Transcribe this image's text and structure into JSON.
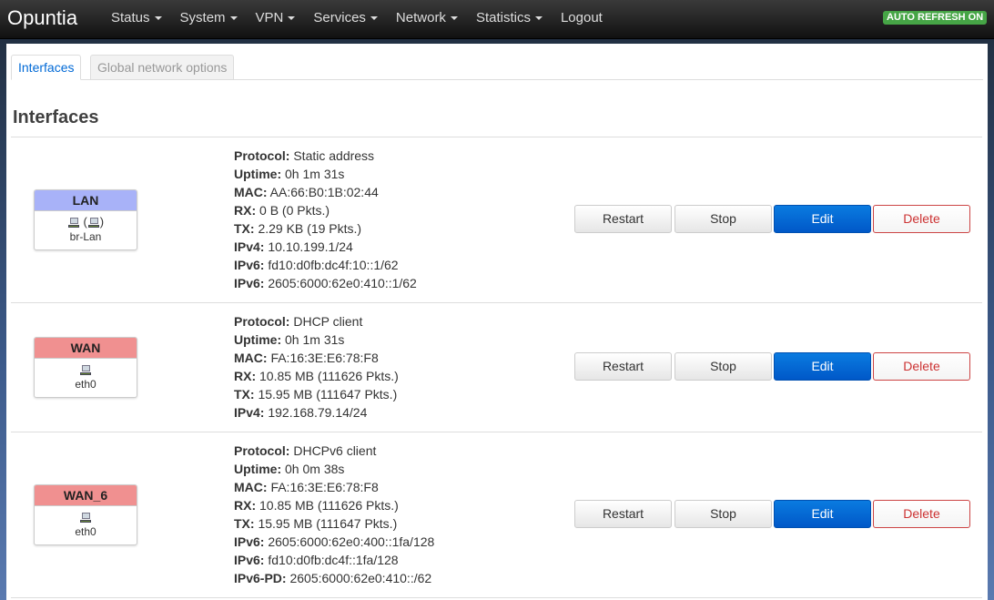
{
  "brand": "Opuntia",
  "menu": [
    {
      "label": "Status",
      "dropdown": true
    },
    {
      "label": "System",
      "dropdown": true
    },
    {
      "label": "VPN",
      "dropdown": true
    },
    {
      "label": "Services",
      "dropdown": true
    },
    {
      "label": "Network",
      "dropdown": true
    },
    {
      "label": "Statistics",
      "dropdown": true
    },
    {
      "label": "Logout",
      "dropdown": false
    }
  ],
  "autorefresh": "AUTO REFRESH ON",
  "tabs": {
    "interfaces": "Interfaces",
    "global": "Global network options"
  },
  "section_title": "Interfaces",
  "buttons": {
    "restart": "Restart",
    "stop": "Stop",
    "edit": "Edit",
    "delete": "Delete"
  },
  "colors": {
    "lan_header": "#a8b2f8",
    "wan_header": "#f09090",
    "edit_blue": "#0069d6",
    "delete_red": "#cc3333",
    "autorefresh_green": "#46a546"
  },
  "interfaces": [
    {
      "name": "LAN",
      "icon_prefix": "",
      "icon_suffix": " (",
      "icon_close": ")",
      "device": "br-Lan",
      "info": [
        {
          "label": "Protocol:",
          "value": "Static address"
        },
        {
          "label": "Uptime:",
          "value": "0h 1m 31s"
        },
        {
          "label": "MAC:",
          "value": "AA:66:B0:1B:02:44"
        },
        {
          "label": "RX:",
          "value": "0 B (0 Pkts.)"
        },
        {
          "label": "TX:",
          "value": "2.29 KB (19 Pkts.)"
        },
        {
          "label": "IPv4:",
          "value": "10.10.199.1/24"
        },
        {
          "label": "IPv6:",
          "value": "fd10:d0fb:dc4f:10::1/62"
        },
        {
          "label": "IPv6:",
          "value": "2605:6000:62e0:410::1/62"
        }
      ]
    },
    {
      "name": "WAN",
      "device": "eth0",
      "info": [
        {
          "label": "Protocol:",
          "value": "DHCP client"
        },
        {
          "label": "Uptime:",
          "value": "0h 1m 31s"
        },
        {
          "label": "MAC:",
          "value": "FA:16:3E:E6:78:F8"
        },
        {
          "label": "RX:",
          "value": "10.85 MB (111626 Pkts.)"
        },
        {
          "label": "TX:",
          "value": "15.95 MB (111647 Pkts.)"
        },
        {
          "label": "IPv4:",
          "value": "192.168.79.14/24"
        }
      ]
    },
    {
      "name": "WAN_6",
      "device": "eth0",
      "info": [
        {
          "label": "Protocol:",
          "value": "DHCPv6 client"
        },
        {
          "label": "Uptime:",
          "value": "0h 0m 38s"
        },
        {
          "label": "MAC:",
          "value": "FA:16:3E:E6:78:F8"
        },
        {
          "label": "RX:",
          "value": "10.85 MB (111626 Pkts.)"
        },
        {
          "label": "TX:",
          "value": "15.95 MB (111647 Pkts.)"
        },
        {
          "label": "IPv6:",
          "value": "2605:6000:62e0:400::1fa/128"
        },
        {
          "label": "IPv6:",
          "value": "fd10:d0fb:dc4f::1fa/128"
        },
        {
          "label": "IPv6-PD:",
          "value": "2605:6000:62e0:410::/62"
        }
      ]
    }
  ]
}
